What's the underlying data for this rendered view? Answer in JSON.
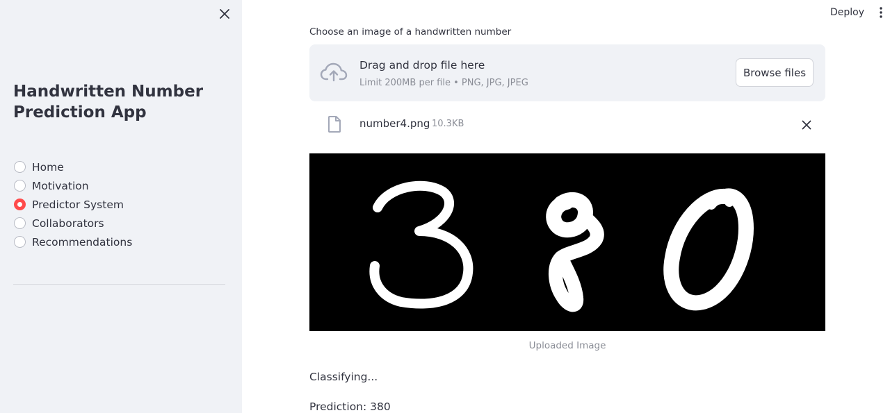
{
  "sidebar": {
    "title": "Handwritten Number Prediction App",
    "nav": [
      {
        "label": "Home",
        "selected": false
      },
      {
        "label": "Motivation",
        "selected": false
      },
      {
        "label": "Predictor System",
        "selected": true
      },
      {
        "label": "Collaborators",
        "selected": false
      },
      {
        "label": "Recommendations",
        "selected": false
      }
    ]
  },
  "header": {
    "deploy_label": "Deploy"
  },
  "uploader": {
    "label": "Choose an image of a handwritten number",
    "dropzone_title": "Drag and drop file here",
    "dropzone_limit": "Limit 200MB per file • PNG, JPG, JPEG",
    "browse_label": "Browse files"
  },
  "uploaded_file": {
    "name": "number4.png",
    "size": "10.3KB"
  },
  "image": {
    "caption": "Uploaded Image"
  },
  "results": {
    "status": "Classifying...",
    "prediction": "Prediction: 380"
  },
  "colors": {
    "accent": "#ff4b4b",
    "sidebar_bg": "#f0f2f6",
    "text": "#31333f",
    "muted": "#8a8d96"
  },
  "icons": {
    "sidebar_close": "close-icon",
    "menu": "vertical-dots-icon",
    "upload": "cloud-upload-icon",
    "file": "file-icon",
    "remove": "close-icon"
  }
}
